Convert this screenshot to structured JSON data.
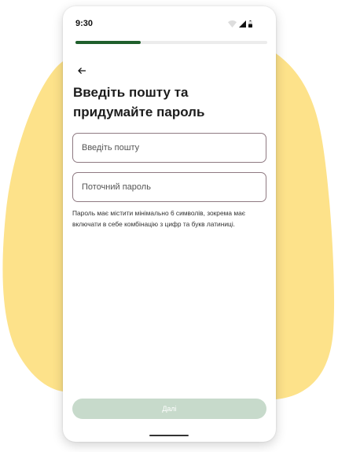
{
  "status_bar": {
    "time": "9:30"
  },
  "progress": {
    "fraction": 0.34,
    "color": "#1f5f2c"
  },
  "screen": {
    "title_line1": "Введіть пошту та",
    "title_line2": "придумайте пароль"
  },
  "form": {
    "email_placeholder": "Введіть пошту",
    "password_placeholder": "Поточний пароль",
    "password_hint": "Пароль має містити мінімально 6 символів, зокрема має включати в себе комбінацію з цифр та букв латиниці."
  },
  "actions": {
    "next_label": "Далі"
  },
  "colors": {
    "accent": "#1f5f2c",
    "background_blob": "#fde28a",
    "button_disabled": "#c7dacb"
  },
  "icons": {
    "back": "arrow-left-icon",
    "wifi": "wifi-icon",
    "signal": "signal-icon",
    "battery": "battery-icon"
  }
}
